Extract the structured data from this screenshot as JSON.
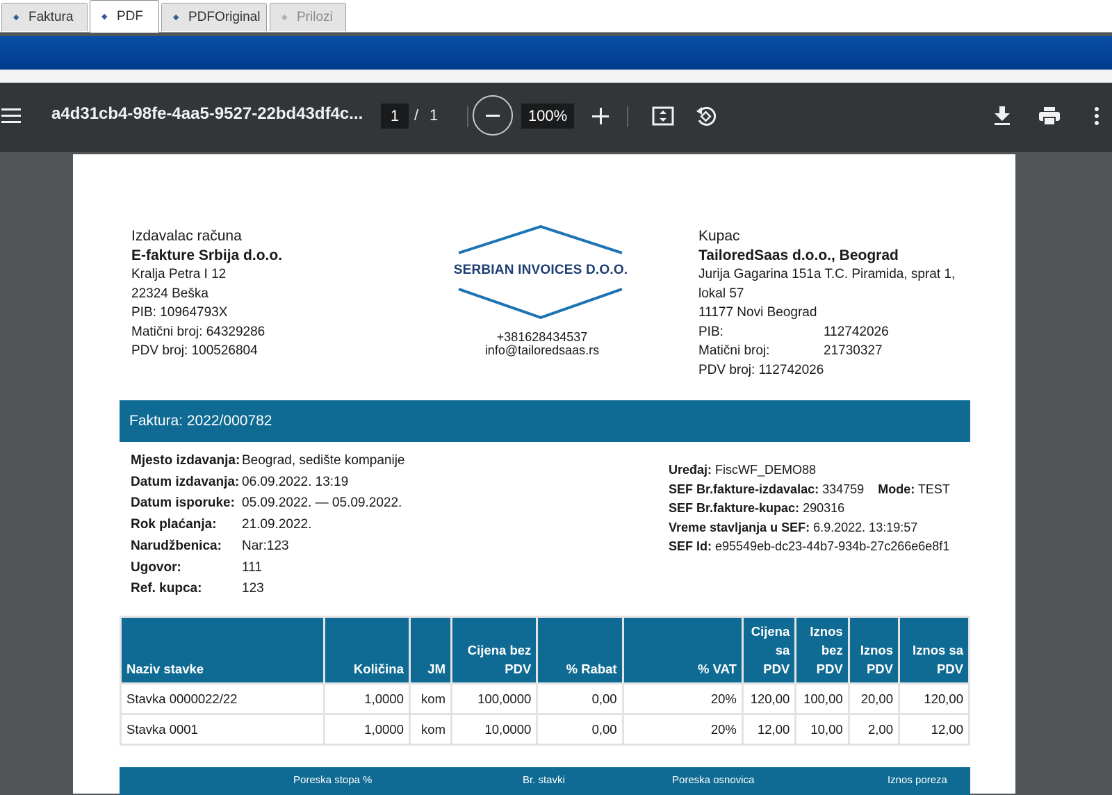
{
  "tabs": [
    {
      "label": "Faktura"
    },
    {
      "label": "PDF"
    },
    {
      "label": "PDFOriginal"
    },
    {
      "label": "Prilozi"
    }
  ],
  "viewer": {
    "file_title": "a4d31cb4-98fe-4aa5-9527-22bd43df4c...",
    "page_current": "1",
    "page_sep": "/",
    "page_total": "1",
    "zoom": "100%"
  },
  "issuer": {
    "heading": "Izdavalac računa",
    "name": "E-fakture Srbija d.o.o.",
    "lines": [
      "Kralja Petra I 12",
      "22324 Beška",
      "PIB: 10964793X",
      "Matični broj: 64329286",
      "PDV broj: 100526804"
    ]
  },
  "logo": {
    "text": "SERBIAN INVOICES D.O.O.",
    "phone": "+381628434537",
    "email": "info@tailoredsaas.rs"
  },
  "buyer": {
    "heading": "Kupac",
    "name": "TailoredSaas d.o.o., Beograd",
    "address1": "Jurija Gagarina 151a T.C. Piramida, sprat 1,",
    "address2": "lokal 57",
    "city": "11177 Novi Beograd",
    "pib_label": "PIB:",
    "pib": "112742026",
    "mb_label": "Matični broj:",
    "mb": "21730327",
    "pdv": "PDV broj: 112742026"
  },
  "invoice": {
    "title": "Faktura: 2022/000782"
  },
  "meta_left": [
    {
      "k": "Mjesto izdavanja:",
      "v": "Beograd, sedište kompanije"
    },
    {
      "k": "Datum izdavanja:",
      "v": "06.09.2022. 13:19"
    },
    {
      "k": "Datum isporuke:",
      "v": "05.09.2022. — 05.09.2022."
    },
    {
      "k": "Rok plaćanja:",
      "v": "21.09.2022."
    },
    {
      "k": "Narudžbenica:",
      "v": "Nar:123"
    },
    {
      "k": "Ugovor:",
      "v": "111"
    },
    {
      "k": "Ref. kupca:",
      "v": "123"
    }
  ],
  "meta_right": {
    "device_label": "Uređaj:",
    "device": "FiscWF_DEMO88",
    "sef_issuer_label": "SEF Br.fakture-izdavalac:",
    "sef_issuer": "334759",
    "mode_label": "Mode:",
    "mode": "TEST",
    "sef_buyer_label": "SEF Br.fakture-kupac:",
    "sef_buyer": "290316",
    "sef_time_label": "Vreme stavljanja u SEF:",
    "sef_time": "6.9.2022. 13:19:57",
    "sef_id_label": "SEF Id:",
    "sef_id": "e95549eb-dc23-44b7-934b-27c266e6e8f1"
  },
  "items_table": {
    "headers": [
      [
        "Naziv stavke"
      ],
      [
        "Količina"
      ],
      [
        "JM"
      ],
      [
        "Cijena bez",
        "PDV"
      ],
      [
        "% Rabat"
      ],
      [
        "% VAT"
      ],
      [
        "Cijena",
        "sa",
        "PDV"
      ],
      [
        "Iznos",
        "bez",
        "PDV"
      ],
      [
        "Iznos",
        "PDV"
      ],
      [
        "Iznos sa",
        "PDV"
      ]
    ],
    "rows": [
      [
        "Stavka 0000022/22",
        "1,0000",
        "kom",
        "100,0000",
        "0,00",
        "20%",
        "120,00",
        "100,00",
        "20,00",
        "120,00"
      ],
      [
        "Stavka 0001",
        "1,0000",
        "kom",
        "10,0000",
        "0,00",
        "20%",
        "12,00",
        "10,00",
        "2,00",
        "12,00"
      ]
    ]
  },
  "tax_summary": {
    "headers": [
      "Poreska stopa %",
      "Br. stavki",
      "Poreska osnovica",
      "Iznos poreza"
    ]
  }
}
